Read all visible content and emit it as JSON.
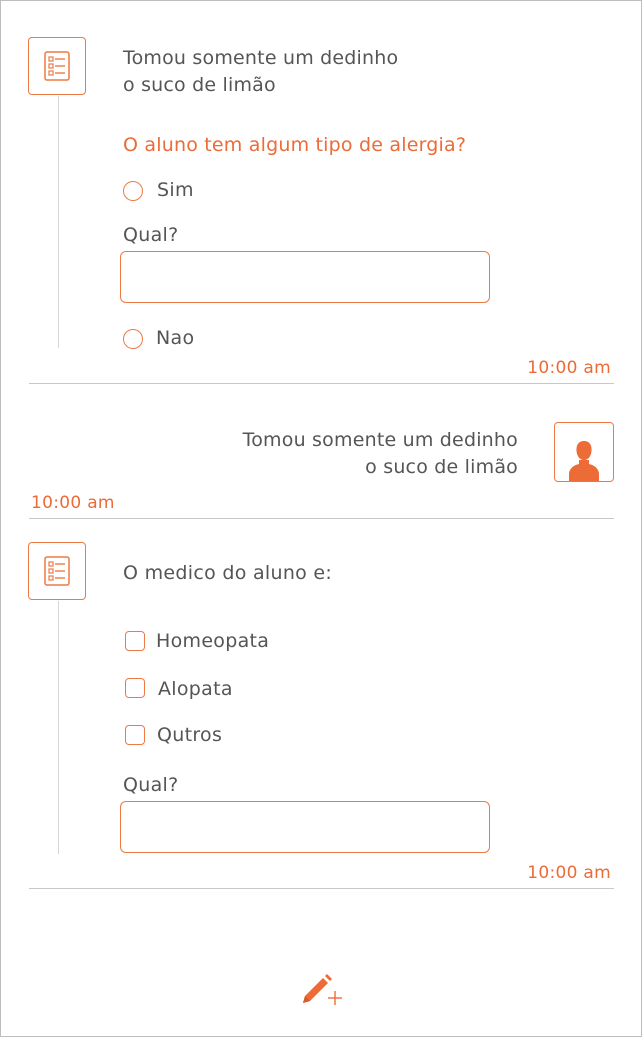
{
  "block1": {
    "message_line1": "Tomou somente um dedinho",
    "message_line2": "o suco de limão",
    "question": "O aluno tem algum tipo de alergia?",
    "option_yes": "Sim",
    "qual_label": "Qual?",
    "qual_value": "",
    "option_no": "Nao",
    "time": "10:00 am"
  },
  "block2": {
    "message_line1": "Tomou somente um dedinho",
    "message_line2": "o suco de limão",
    "time": "10:00 am"
  },
  "block3": {
    "question": "O medico do aluno e:",
    "options": [
      "Homeopata",
      "Alopata",
      "Qutros"
    ],
    "qual_label": "Qual?",
    "qual_value": "",
    "time": "10:00 am"
  },
  "icons": {
    "form": "checklist-icon",
    "avatar": "person-icon",
    "compose": "pencil-plus-icon"
  },
  "colors": {
    "accent": "#ec6b36",
    "text": "#555555",
    "divider": "#c8c8c8"
  }
}
